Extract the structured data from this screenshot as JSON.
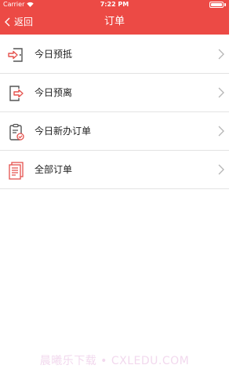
{
  "status_bar": {
    "carrier": "Carrier",
    "time": "7:22 PM"
  },
  "nav": {
    "back_label": "返回",
    "title": "订单"
  },
  "menu": [
    {
      "label": "今日预抵",
      "icon": "check-in-icon"
    },
    {
      "label": "今日预离",
      "icon": "check-out-icon"
    },
    {
      "label": "今日新办订单",
      "icon": "new-order-icon"
    },
    {
      "label": "全部订单",
      "icon": "all-orders-icon"
    }
  ],
  "watermark": "晨曦乐下载 • CXLEDU.COM",
  "colors": {
    "brand": "#ec4a45",
    "icon_red": "#e5524d",
    "icon_dark": "#555555",
    "divider": "#e3e3e3"
  }
}
